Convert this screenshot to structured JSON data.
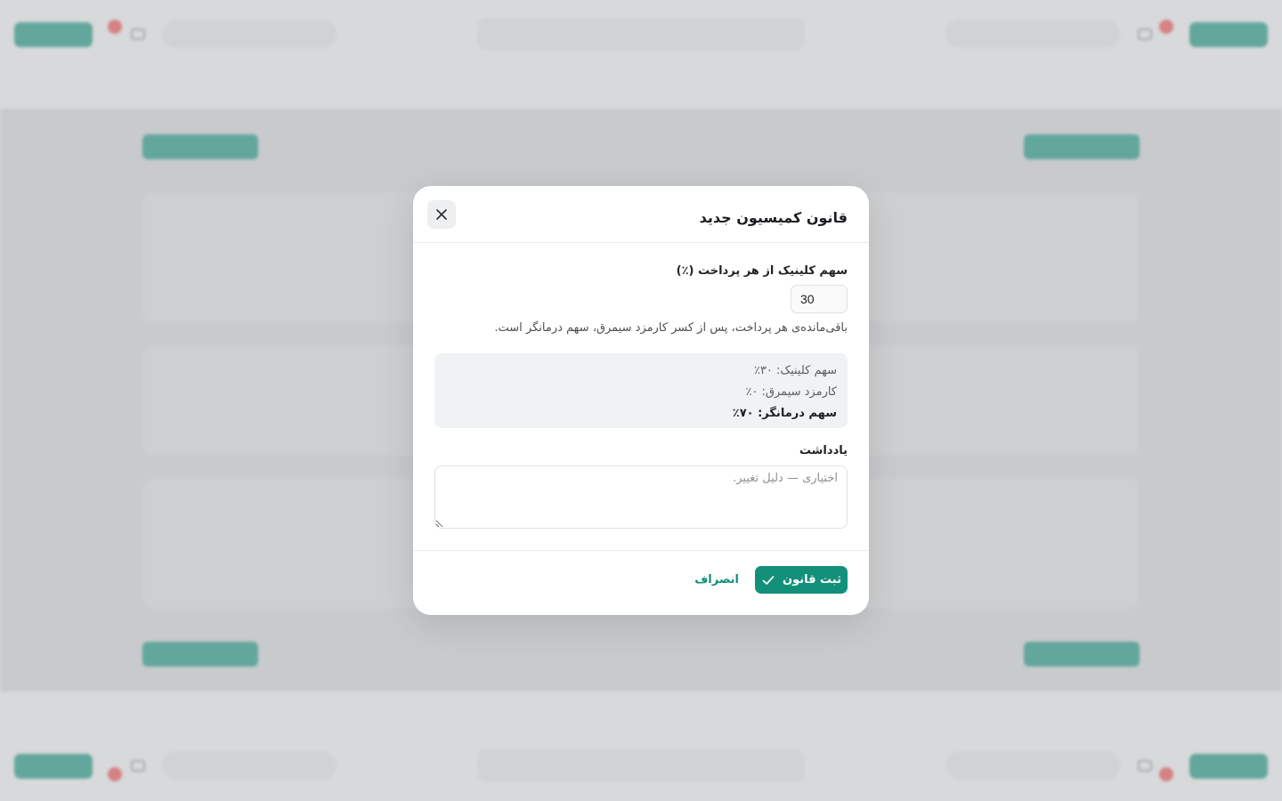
{
  "modal": {
    "title": "قانون کمیسیون جدید",
    "share_label": "سهم کلینیک از هر پرداخت (٪)",
    "share_value": "30",
    "helper_text": "باقی‌مانده‌ی هر پرداخت، پس از کسر کارمزد سیمرق، سهم درمانگر است.",
    "summary": {
      "clinic_share": "سهم کلینیک: ۳۰٪",
      "simorgh_fee": "کارمزد سیمرق: ۰٪",
      "therapist_share": "سهم درمانگر: ۷۰٪"
    },
    "note_label": "یادداشت",
    "note_placeholder": "اختیاری — دلیل تغییر.",
    "save_label": "ثبت قانون",
    "cancel_label": "انصراف"
  },
  "colors": {
    "accent": "#12907a",
    "background_bar": "#118a75",
    "badge": "#e0484a"
  }
}
